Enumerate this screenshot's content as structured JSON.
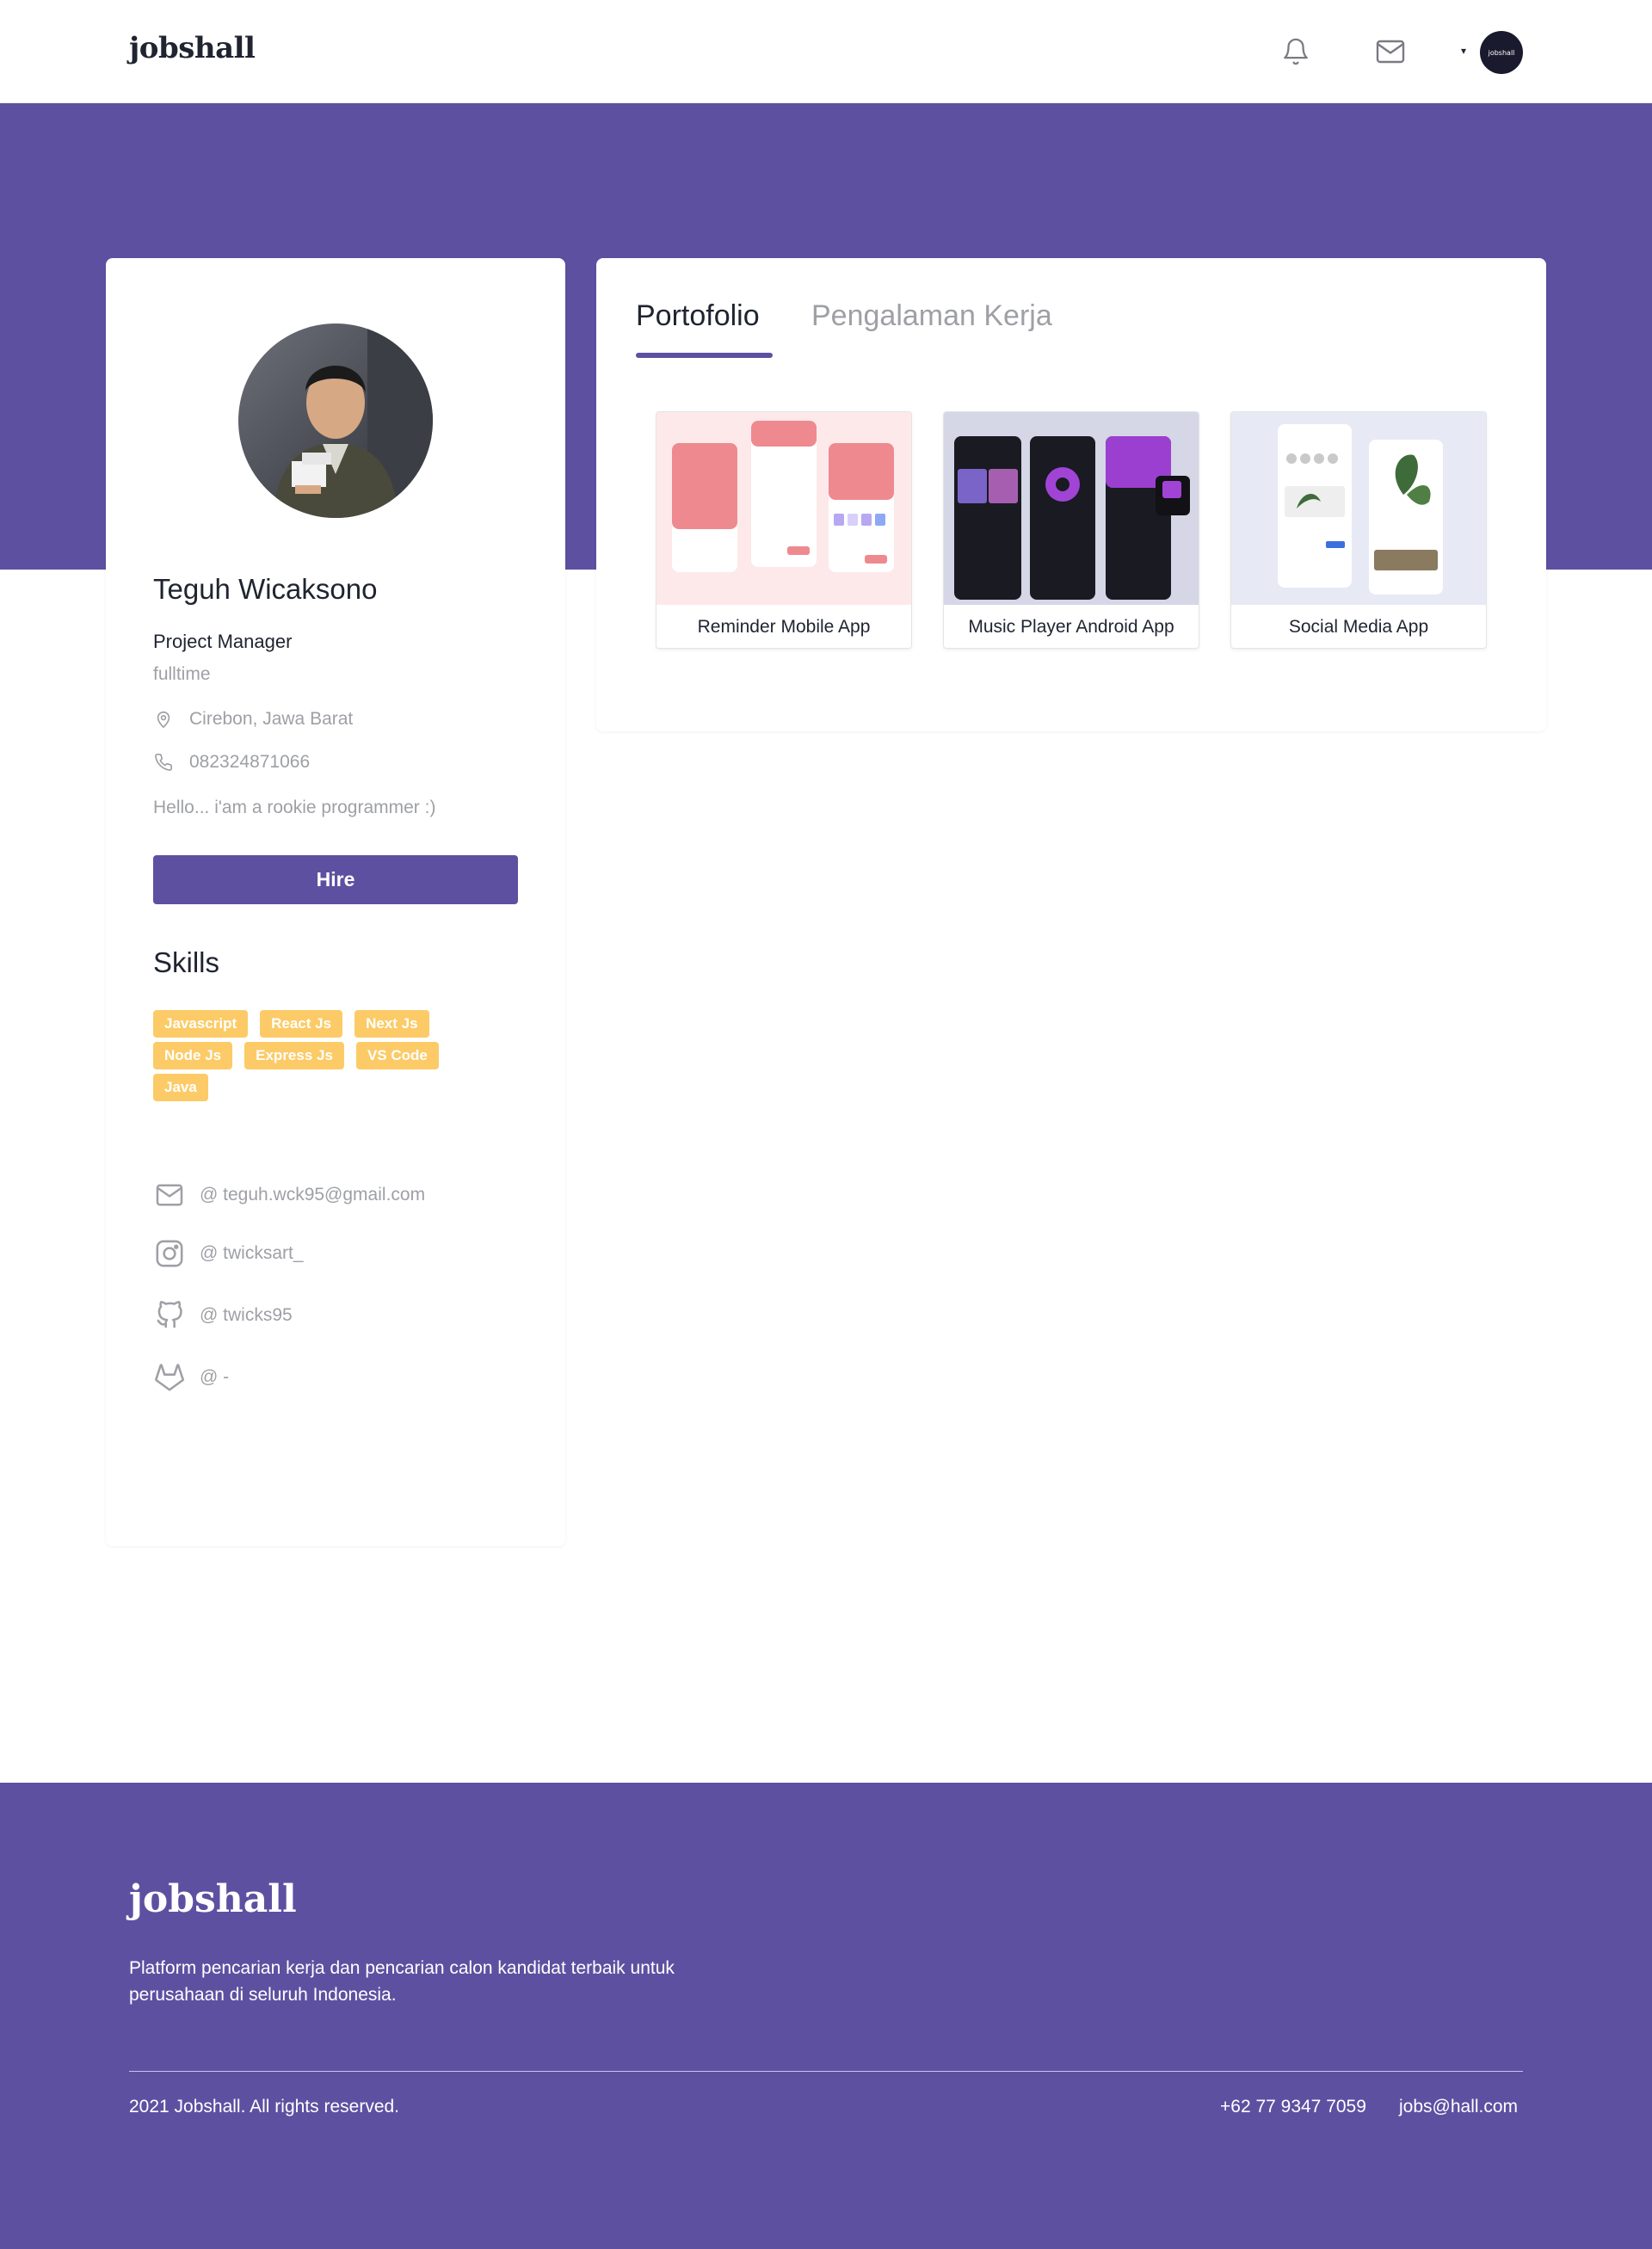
{
  "brand": {
    "logo": "jobshall",
    "accent": "#5e50a1",
    "skill_color": "#fbb017"
  },
  "navbar": {
    "icons": [
      "bell-icon",
      "mail-icon",
      "chevron-down-icon"
    ],
    "avatar_text": "jobshall"
  },
  "profile": {
    "name": "Teguh Wicaksono",
    "role": "Project Manager",
    "type": "fulltime",
    "location": "Cirebon, Jawa Barat",
    "phone": "082324871066",
    "bio": "Hello... i'am a rookie programmer :)",
    "hire_label": "Hire",
    "skills_title": "Skills",
    "skills": [
      "Javascript",
      "React Js",
      "Next Js",
      "Node Js",
      "Express Js",
      "VS Code",
      "Java"
    ],
    "contacts": {
      "email": "@ teguh.wck95@gmail.com",
      "instagram": "@ twicksart_",
      "github": "@ twicks95",
      "gitlab": "@ -"
    }
  },
  "tabs": {
    "portfolio": "Portofolio",
    "experience": "Pengalaman Kerja"
  },
  "portfolio": [
    {
      "title": "Reminder Mobile App"
    },
    {
      "title": "Music Player Android App"
    },
    {
      "title": "Social Media App"
    }
  ],
  "footer": {
    "logo": "jobshall",
    "description": "Platform pencarian kerja dan pencarian calon kandidat terbaik untuk perusahaan di seluruh Indonesia.",
    "copyright": "2021 Jobshall. All rights reserved.",
    "phone": "+62 77 9347 7059",
    "email": "jobs@hall.com"
  }
}
